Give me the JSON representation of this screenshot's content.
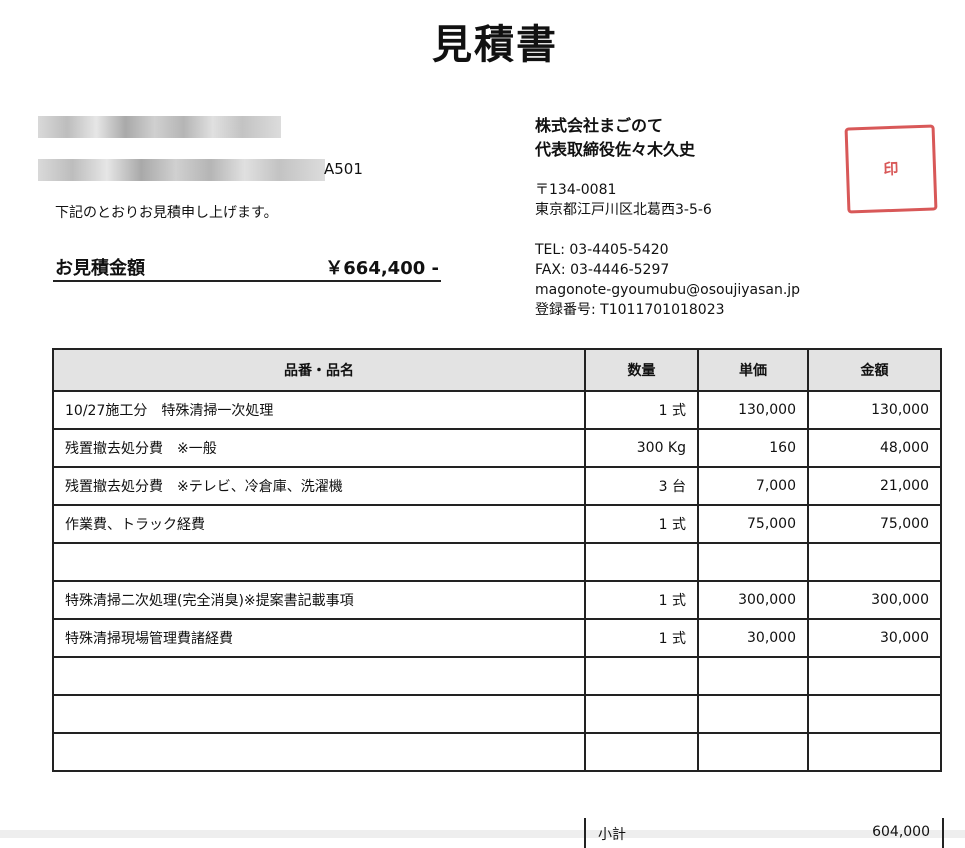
{
  "document": {
    "title": "見積書"
  },
  "recipient": {
    "line2_suffix": "A501",
    "greeting": "下記のとおりお見積申し上げます。"
  },
  "amount": {
    "label": "お見積金額",
    "value": "￥664,400 -"
  },
  "issuer": {
    "company": "株式会社まごのて",
    "representative": "代表取締役佐々木久史",
    "postal": "〒134-0081",
    "address": "東京都江戸川区北葛西3-5-6",
    "tel": "TEL: 03-4405-5420",
    "fax": "FAX: 03-4446-5297",
    "email": "magonote-gyoumubu@osoujiyasan.jp",
    "registration": "登録番号: T1011701018023",
    "seal_color": "#d23c3c"
  },
  "table": {
    "headers": {
      "item": "品番・品名",
      "qty": "数量",
      "unit_price": "単価",
      "amount": "金額"
    },
    "rows": [
      {
        "item": "10/27施工分　特殊清掃一次処理",
        "qty": "1 式",
        "unit_price": "130,000",
        "amount": "130,000"
      },
      {
        "item": "残置撤去処分費　※一般",
        "qty": "300 Kg",
        "unit_price": "160",
        "amount": "48,000"
      },
      {
        "item": "残置撤去処分費　※テレビ、冷倉庫、洗濯機",
        "qty": "3 台",
        "unit_price": "7,000",
        "amount": "21,000"
      },
      {
        "item": "作業費、トラック経費",
        "qty": "1 式",
        "unit_price": "75,000",
        "amount": "75,000"
      },
      {
        "item": "",
        "qty": "",
        "unit_price": "",
        "amount": ""
      },
      {
        "item": "特殊清掃二次処理(完全消臭)※提案書記載事項",
        "qty": "1 式",
        "unit_price": "300,000",
        "amount": "300,000"
      },
      {
        "item": "特殊清掃現場管理費諸経費",
        "qty": "1 式",
        "unit_price": "30,000",
        "amount": "30,000"
      },
      {
        "item": "",
        "qty": "",
        "unit_price": "",
        "amount": ""
      },
      {
        "item": "",
        "qty": "",
        "unit_price": "",
        "amount": ""
      },
      {
        "item": "",
        "qty": "",
        "unit_price": "",
        "amount": ""
      }
    ]
  },
  "subtotal": {
    "label": "小計",
    "value": "604,000"
  }
}
